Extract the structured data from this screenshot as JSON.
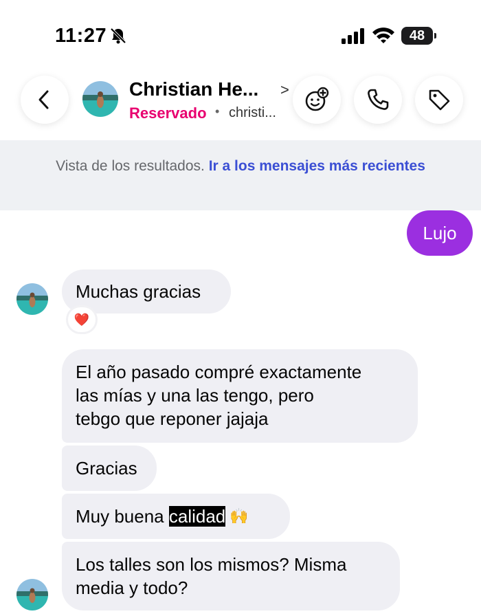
{
  "status_bar": {
    "time": "11:27",
    "battery": "48",
    "icons": [
      "bell-slash-icon",
      "cellular-signal-icon",
      "wifi-icon",
      "battery-icon"
    ]
  },
  "header": {
    "contact_name": "Christian He...",
    "contact_status": "Reservado",
    "contact_handle": "christi...",
    "icons": [
      "back-chevron-icon",
      "chevron-right-icon",
      "effects-icon",
      "phone-icon",
      "tag-icon"
    ],
    "status_color": "#e8006f"
  },
  "banner": {
    "text": "Vista de los resultados.",
    "link": "Ir a los mensajes más recientes",
    "link_color": "#3b4fd4"
  },
  "messages": [
    {
      "sender": "me",
      "text": "Lujo"
    },
    {
      "sender": "them",
      "text": "Muchas gracias",
      "reaction": "❤️"
    },
    {
      "sender": "them",
      "lines": [
        "El año pasado compré exactamente",
        "las mías y una las tengo, pero",
        "tebgo que reponer jajaja"
      ]
    },
    {
      "sender": "them",
      "text": "Gracias"
    },
    {
      "sender": "them",
      "prefix": "Muy buena ",
      "highlighted": "calidad",
      "emoji": "🙌"
    },
    {
      "sender": "them",
      "lines": [
        "Los talles son los mismos? Misma",
        "media y todo?"
      ]
    }
  ],
  "colors": {
    "outgoing_bubble": "#9b2fe0",
    "incoming_bubble": "#efeff4",
    "banner_bg": "#eff1f4"
  }
}
